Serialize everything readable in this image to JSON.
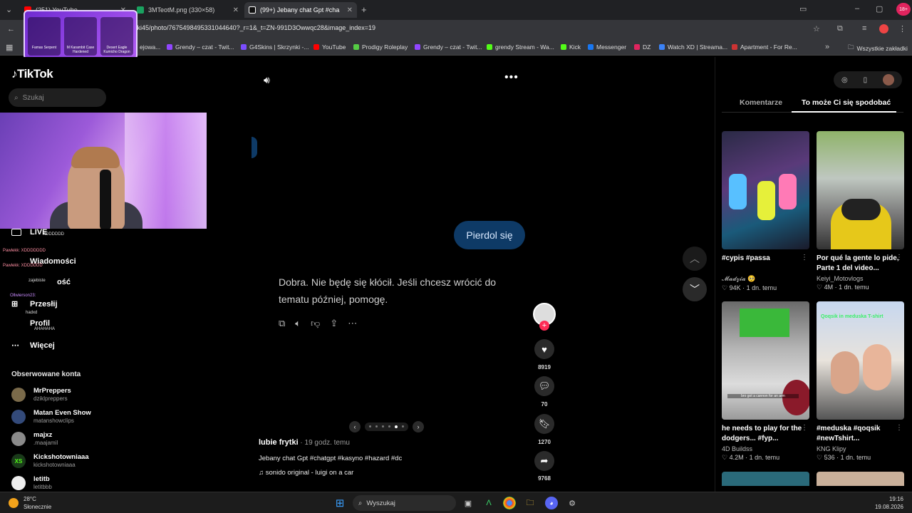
{
  "browser": {
    "tabs": [
      {
        "label": "(251) YouTube",
        "color": "#ff0000"
      },
      {
        "label": "3MTeotM.png (330×58)",
        "color": "#1aa260"
      },
      {
        "label": "(99+) Jebany chat Gpt #cha",
        "color": "#111111"
      }
    ],
    "url": "tki45/photo/7675498495331044640?_r=1&_t=ZN-991D3Owwqc28&image_index=19",
    "bookmarks": [
      {
        "label": "Grendy – czat - Twit...",
        "color": "#9146ff"
      },
      {
        "label": "G4Skins | Skrzynki -...",
        "color": "#7b4dff"
      },
      {
        "label": "YouTube",
        "color": "#ff0000"
      },
      {
        "label": "Prodigy Roleplay",
        "color": "#55cc44"
      },
      {
        "label": "Grendy – czat - Twit...",
        "color": "#9146ff"
      },
      {
        "label": "grendy Stream - Wa...",
        "color": "#53fc18"
      },
      {
        "label": "Kick",
        "color": "#53fc18"
      },
      {
        "label": "Messenger",
        "color": "#1877f2"
      },
      {
        "label": "DZ",
        "color": "#e0245e"
      },
      {
        "label": "Watch XD | Streama...",
        "color": "#3b82f6"
      },
      {
        "label": "Apartment - For Re...",
        "color": "#cc3333"
      }
    ],
    "bookmarks_partial": "ejowa...",
    "all_bookmarks": "Wszystkie zakładki"
  },
  "overlay": {
    "items": [
      {
        "label": "Famas Serpent"
      },
      {
        "label": "M Karambit Case Hardened"
      },
      {
        "label": "Desert Eagle Kumicho Dragon"
      }
    ]
  },
  "sidebar": {
    "logo": "TikTok",
    "search_placeholder": "Szukaj",
    "nav": [
      {
        "label": "LIVE"
      },
      {
        "label": "Wiadomości"
      },
      {
        "label": "ość"
      },
      {
        "label": "Przesłij"
      },
      {
        "label": "Profil"
      },
      {
        "label": "Więcej"
      }
    ],
    "chat": [
      {
        "text": "XDDDDDD"
      },
      {
        "text": "Pawlekk: XDDDDDDD"
      },
      {
        "text": "Pawlekk: XDDDDDD"
      },
      {
        "text": "zajebiste"
      },
      {
        "text": "Ollwierson23:"
      },
      {
        "text": "hadxd"
      },
      {
        "text": "AHAHAHA"
      }
    ],
    "followed_title": "Obserwowane konta",
    "accounts": [
      {
        "name": "MrPreppers",
        "handle": "dziklpreppers"
      },
      {
        "name": "Matan Even Show",
        "handle": "matanshowclips"
      },
      {
        "name": "majxz",
        "handle": ".maajamil"
      },
      {
        "name": "Kickshotowniaaa",
        "handle": "kickshotowniaaa"
      },
      {
        "name": "letitb",
        "handle": "letitbbb"
      }
    ]
  },
  "post": {
    "user_message": "Pierdol się",
    "reply": "Dobra. Nie będę się kłócił. Jeśli chcesz wrócić do tematu później, pomogę.",
    "author": "lubie frytki",
    "time": " · 19 godz. temu",
    "caption": "Jebany chat Gpt #chatgpt #kasyno #hazard #dc",
    "sound": "sonido original - luigi on a car",
    "likes": "8919",
    "comments": "70",
    "saves": "1270",
    "shares": "9768"
  },
  "right_panel": {
    "tab_comments": "Komentarze",
    "tab_suggested": "To może Ci się spodobać",
    "cards": [
      {
        "title": "#cypis #passa",
        "author": "𝓜𝓪𝓭𝔃𝓲𝓪 🥺",
        "stats": "♡ 94K · 1 dn. temu",
        "thumb_text": ""
      },
      {
        "title": "Por qué la gente lo pide, Parte 1 del video...",
        "author": "Keiyi_Motovlogs",
        "stats": "♡ 4M · 1 dn. temu",
        "thumb_text": ""
      },
      {
        "title": "he needs to play for the dodgers... #fyp...",
        "author": "4D Buildss",
        "stats": "♡ 4.2M · 1 dn. temu",
        "thumb_text": "bro got a cannon for an arm"
      },
      {
        "title": "#meduska #qoqsik #newTshirt...",
        "author": "KNG Klipy",
        "stats": "♡ 536 · 1 dn. temu",
        "thumb_text": "Qoqsik in meduska T-shirt"
      }
    ]
  },
  "taskbar": {
    "temp": "28°C",
    "weather": "Słonecznie",
    "search": "Wyszukaj",
    "time": "19:16",
    "date": "19.08.2026"
  }
}
